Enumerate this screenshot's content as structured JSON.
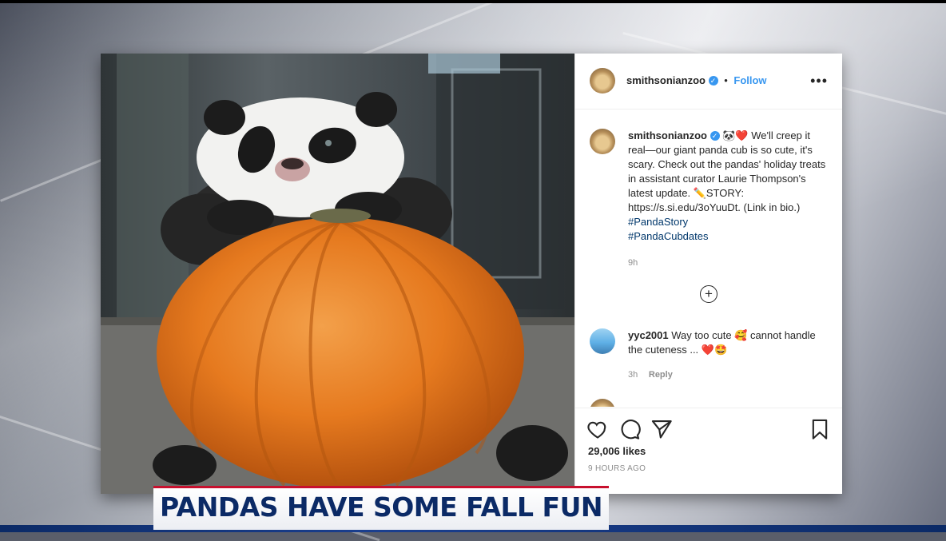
{
  "post": {
    "header": {
      "username": "smithsonianzoo",
      "separator": "•",
      "follow_label": "Follow",
      "more_icon": "more-horizontal-icon"
    },
    "caption": {
      "username": "smithsonianzoo",
      "emoji": "🐼❤️",
      "line1": "We'll creep it real—our giant panda cub is so cute, it's scary. Check out the pandas' holiday treats in assistant curator Laurie Thompson's latest update.",
      "story_prefix": "✏️STORY: https://s.si.edu/3oYuuDt.",
      "link_note": "(Link in bio.)",
      "hashtag1": "#PandaStory",
      "hashtag2": "#PandaCubdates",
      "time": "9h"
    },
    "comment": {
      "username": "yyc2001",
      "text": "Way too cute 🥰 cannot handle the cuteness ... ❤️🤩",
      "time": "3h",
      "reply_label": "Reply"
    },
    "likes": "29,006 likes",
    "posted_ago": "9 HOURS AGO"
  },
  "chyron": {
    "text": "PANDAS HAVE SOME FALL FUN"
  },
  "colors": {
    "link_blue": "#3897f0",
    "hashtag": "#00376b",
    "chyron_navy": "#0b2a66",
    "chyron_red": "#c8102e"
  }
}
